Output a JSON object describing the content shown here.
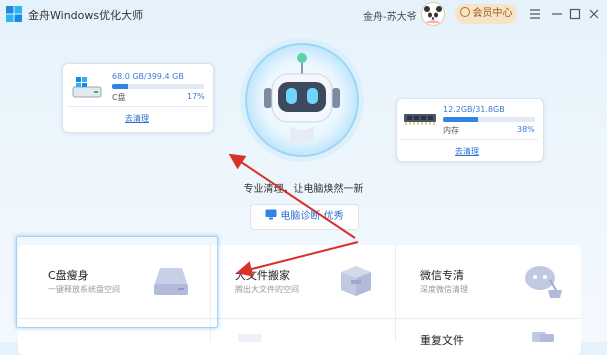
{
  "app": {
    "title": "金舟Windows优化大师",
    "logo_icon": "windows-logo-icon"
  },
  "user": {
    "name": "金舟-苏大爷",
    "avatar_icon": "panda-avatar-icon"
  },
  "header": {
    "member_label": "会员中心"
  },
  "window_controls": [
    "menu-icon",
    "minimize-icon",
    "maximize-icon",
    "close-icon"
  ],
  "disk": {
    "usage": "68.0 GB/399.4 GB",
    "label": "C盘",
    "percent_text": "17%",
    "percent": 17,
    "action": "去清理"
  },
  "memory": {
    "usage": "12.2GB/31.8GB",
    "label": "内存",
    "percent_text": "38%",
    "percent": 38,
    "action": "去清理"
  },
  "slogan": "专业清理，让电脑焕然一新",
  "diagnose_button": "电脑诊断·优秀",
  "tools": [
    {
      "title": "C盘瘦身",
      "subtitle": "一键释放系统盘空间"
    },
    {
      "title": "大文件搬家",
      "subtitle": "腾出大文件的空间"
    },
    {
      "title": "微信专清",
      "subtitle": "深度微信清理"
    },
    {
      "title": "重复文件"
    }
  ],
  "colors": {
    "accent": "#2f84e6",
    "link": "#2a6fd1",
    "arrow": "#d9302a",
    "member_bg": "#f7e4c8"
  }
}
